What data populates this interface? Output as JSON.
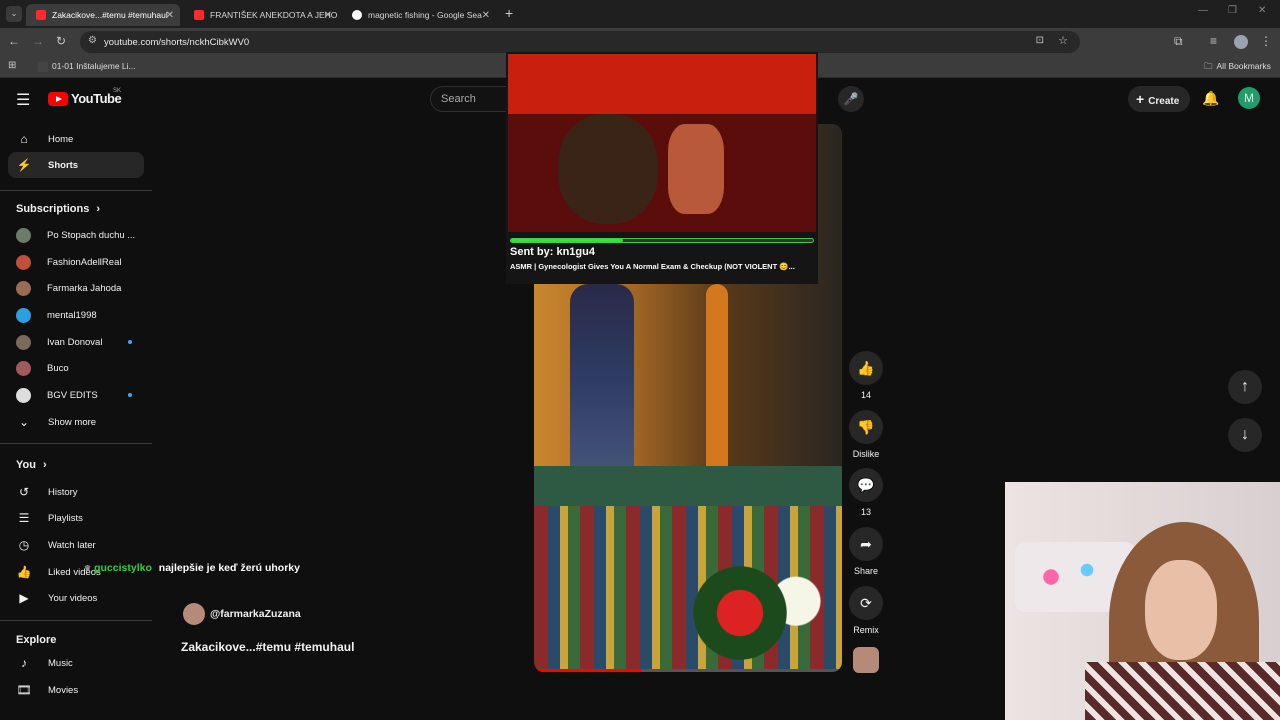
{
  "browser": {
    "tabs": [
      {
        "title": "Zakacikove...#temu #temuhaul",
        "active": true
      },
      {
        "title": "FRANTIŠEK ANEKDOTA A JEHO",
        "active": false
      },
      {
        "title": "magnetic fishing - Google Sea",
        "active": false
      }
    ],
    "url": "youtube.com/shorts/nckhCibkWV0",
    "bookmark_item": "01-01 Inštalujeme Li...",
    "all_bookmarks": "All Bookmarks"
  },
  "youtube": {
    "logo_text": "YouTube",
    "region": "SK",
    "search_placeholder": "Search",
    "create_label": "Create",
    "avatar_letter": "M"
  },
  "sidebar": {
    "top": [
      {
        "label": "Home",
        "icon": "home-icon"
      },
      {
        "label": "Shorts",
        "icon": "shorts-icon",
        "active": true
      }
    ],
    "subscriptions_heading": "Subscriptions",
    "subscriptions": [
      {
        "label": "Po Stopach duchu ...",
        "color": "#6b7c6b",
        "dot": false
      },
      {
        "label": "FashionAdellReal",
        "color": "#c0503a",
        "dot": false
      },
      {
        "label": "Farmarka Jahoda",
        "color": "#9a6b55",
        "dot": false
      },
      {
        "label": "mental1998",
        "color": "#2aa0e0",
        "dot": false
      },
      {
        "label": "Ivan Donoval",
        "color": "#7a6a5a",
        "dot": true
      },
      {
        "label": "Buco",
        "color": "#a05a5a",
        "dot": false
      },
      {
        "label": "BGV EDITS",
        "color": "#dddddd",
        "dot": true
      }
    ],
    "show_more": "Show more",
    "you_heading": "You",
    "you_items": [
      {
        "label": "History",
        "icon": "history-icon"
      },
      {
        "label": "Playlists",
        "icon": "playlists-icon"
      },
      {
        "label": "Watch later",
        "icon": "watch-later-icon"
      },
      {
        "label": "Liked videos",
        "icon": "like-icon"
      },
      {
        "label": "Your videos",
        "icon": "your-videos-icon"
      }
    ],
    "explore_heading": "Explore",
    "explore_items": [
      {
        "label": "Music",
        "icon": "music-icon"
      },
      {
        "label": "Movies",
        "icon": "movies-icon"
      }
    ]
  },
  "chat_overlay": {
    "user": "guccistylko",
    "message": "najlepšie je keď žerú uhorky"
  },
  "popup": {
    "sent_by": "Sent by: kn1gu4",
    "title": "ASMR | Gynecologist Gives You A Normal Exam & Checkup (NOT VIOLENT 😊...",
    "progress": 0.37
  },
  "short": {
    "channel": "@farmarkaZuzana",
    "title": "Zakacikove...#temu #temuhaul",
    "progress": 0.35
  },
  "actions": {
    "likes": "14",
    "dislike": "Dislike",
    "comments": "13",
    "share": "Share",
    "remix": "Remix"
  }
}
